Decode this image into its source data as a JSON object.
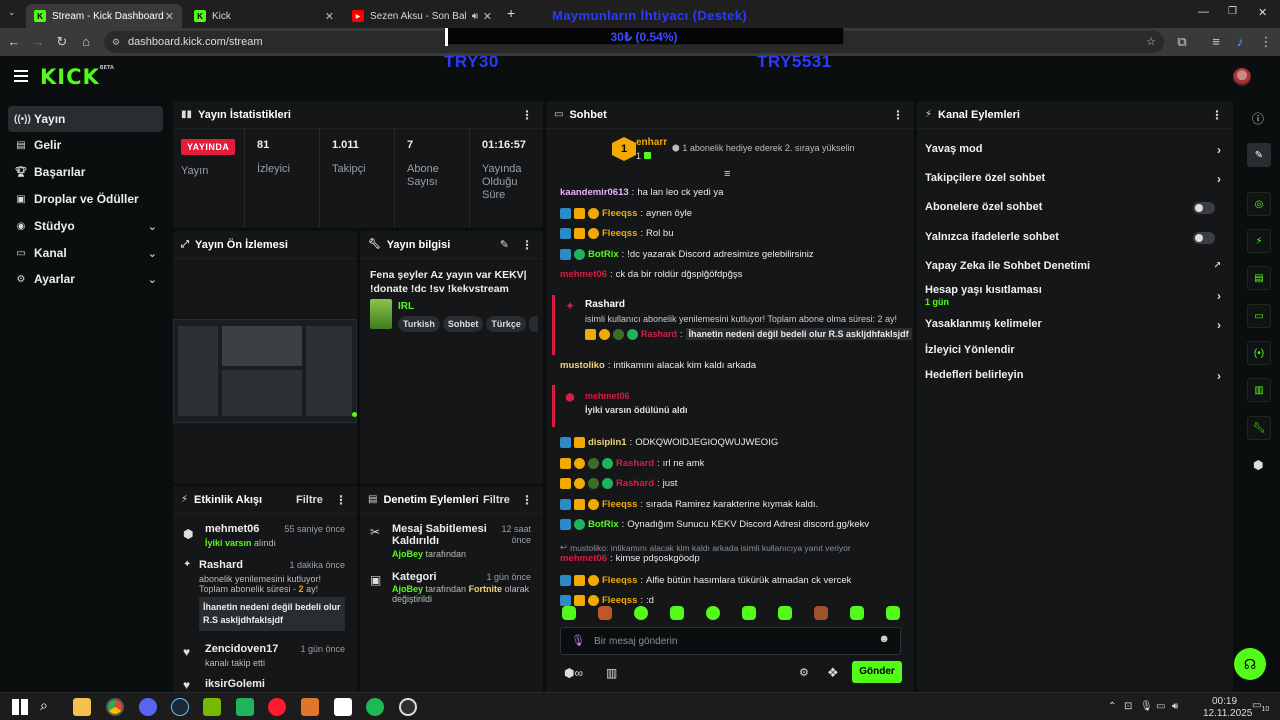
{
  "browser": {
    "tabs": [
      {
        "title": "Stream - Kick Dashboard",
        "active": true
      },
      {
        "title": "Kick",
        "active": false
      },
      {
        "title": "Sezen Aksu - Son Bakış (Ly",
        "active": false
      }
    ],
    "url": "dashboard.kick.com/stream"
  },
  "overlay": {
    "title": "Maymunların İhtiyacı (Destek)",
    "progress_text": "30₺ (0.54%)",
    "goal_left": "TRY30",
    "goal_right": "TRY5531",
    "progress": 0.0054
  },
  "kick": {
    "logo": "KICK",
    "logo_sup": "BETA"
  },
  "sidebar": {
    "items": [
      {
        "label": "Yayın",
        "icon": "broadcast-icon"
      },
      {
        "label": "Gelir",
        "icon": "revenue-icon"
      },
      {
        "label": "Başarılar",
        "icon": "trophy-icon"
      },
      {
        "label": "Droplar ve Ödüller",
        "icon": "gift-icon"
      },
      {
        "label": "Stüdyo",
        "icon": "studio-icon"
      },
      {
        "label": "Kanal",
        "icon": "channel-icon"
      },
      {
        "label": "Ayarlar",
        "icon": "gear-icon"
      }
    ]
  },
  "stats": {
    "title": "Yayın İstatistikleri",
    "live_badge": "YAYINDA",
    "live_label": "Yayın",
    "viewers": "81",
    "viewers_label": "İzleyici",
    "followers": "1.011",
    "followers_label": "Takipçi",
    "subs": "7",
    "subs_label": "Abone Sayısı",
    "duration": "01:16:57",
    "duration_label": "Yayında Olduğu Süre"
  },
  "preview": {
    "title": "Yayın Ön İzlemesi"
  },
  "info": {
    "title": "Yayın bilgisi",
    "stream_title": "Fena şeyler Az yayın var KEKV| !donate !dc !sv !kekvstream",
    "category": "IRL",
    "tags": [
      "Turkish",
      "Sohbet",
      "Türkçe"
    ]
  },
  "activity": {
    "title": "Etkinlik Akışı",
    "filter": "Filtre",
    "items": [
      {
        "name": "mehmet06",
        "time": "55 saniye önce",
        "sub_green": "İyiki varsın",
        "sub_rest": " alındı"
      },
      {
        "name": "Rashard",
        "time": "1 dakika önce",
        "line1": "abonelik yenilemesini kutluyor!",
        "line2a": "Toplam abonelik süresi - ",
        "line2b": "2",
        "line2c": " ay!",
        "message": "İhanetin nedeni değil bedeli olur R.S askljdhfaklsjdf"
      },
      {
        "name": "Zencidoven17",
        "time": "1 gün önce",
        "sub": "kanalı takip etti"
      },
      {
        "name": "iksirGolemi",
        "time": ""
      }
    ]
  },
  "moderation": {
    "title": "Denetim Eylemleri",
    "filter": "Filtre",
    "items": [
      {
        "title1": "Mesaj Sabitlemesi",
        "title2": "Kaldırıldı",
        "time1": "12 saat",
        "time2": "önce",
        "by": "AjoBey",
        "by_suffix": " tarafından"
      },
      {
        "title1": "Kategori",
        "time1": "1 gün önce",
        "by": "AjoBey",
        "by_suffix": " tarafından ",
        "target": "Fortnite",
        "target_suffix": " olarak",
        "line2": "değiştirildi"
      }
    ]
  },
  "chat": {
    "title": "Sohbet",
    "pinned_user": "enharr",
    "pinned_rank": "1",
    "pinned_text": "1 abonelik hediye ederek 2. sıraya yükselin",
    "messages": [
      {
        "user": "kaandemir0613",
        "color": "#e8b3ff",
        "text": "ha lan leo ck yedi ya",
        "badges": []
      },
      {
        "user": "Fleeqss",
        "color": "#f2a900",
        "text": "aynen öyle",
        "badges": [
          "b1",
          "b2",
          "b3"
        ]
      },
      {
        "user": "Fleeqss",
        "color": "#f2a900",
        "text": "Rol bu",
        "badges": [
          "b1",
          "b2",
          "b3"
        ]
      },
      {
        "user": "BotRix",
        "color": "#53fc18",
        "text": "!dc yazarak Discord adresimize gelebilirsiniz",
        "badges": [
          "b1",
          "b4"
        ]
      },
      {
        "user": "mehmet06",
        "color": "#d91c41",
        "text": "ck da bir roldür dğsplğöfdpğşs",
        "badges": []
      }
    ],
    "highlight1": {
      "user": "Rashard",
      "line1": "isimli kullanıcı abonelik yenilemesini kutluyor! Toplam abone olma süresi: 2 ay!",
      "msg_user": "Rashard",
      "msg_text": "İhanetin nedeni değil bedeli olur R.S askljdhfaklsjdf"
    },
    "msg_after1": {
      "user": "mustoliko",
      "color": "#f2d479",
      "text": "intikamını alacak kim kaldı arkada"
    },
    "highlight2": {
      "user": "mehmet06",
      "text": "İyiki varsın ödülünü aldı"
    },
    "messages2": [
      {
        "user": "disiplin1",
        "color": "#f2d479",
        "text": "ODKQWOIDJEGIOQWUJWEOIG",
        "badges": [
          "b1",
          "b2"
        ]
      },
      {
        "user": "Rashard",
        "color": "#d91c41",
        "text": "ırl ne amk",
        "badges": [
          "b2",
          "b3",
          "b5",
          "b4"
        ]
      },
      {
        "user": "Rashard",
        "color": "#d91c41",
        "text": "just",
        "badges": [
          "b2",
          "b3",
          "b5",
          "b4"
        ]
      },
      {
        "user": "Fleeqss",
        "color": "#f2a900",
        "text": "sırada Ramirez karakterine kıymak kaldı.",
        "badges": [
          "b1",
          "b2",
          "b3"
        ]
      },
      {
        "user": "BotRix",
        "color": "#53fc18",
        "text": "Oynadığım Sunucu KEKV Discord Adresi discord.gg/kekv",
        "badges": [
          "b1",
          "b4"
        ]
      }
    ],
    "reply_ctx": "mustoliko: intikamını alacak kim kaldı arkada isimli kullanıcıya yanıt veriyor",
    "reply_msg": {
      "user": "mehmet06",
      "color": "#d91c41",
      "text": "kimse pdşoskgöodp"
    },
    "messages3": [
      {
        "user": "Fleeqss",
        "color": "#f2a900",
        "text": "Alfie bütün hasımlara tükürük atmadan ck vercek",
        "badges": [
          "b1",
          "b2",
          "b3"
        ]
      },
      {
        "user": "Fleeqss",
        "color": "#f2a900",
        "text": ":d",
        "badges": [
          "b1",
          "b2",
          "b3"
        ]
      }
    ],
    "input_placeholder": "Bir mesaj gönderin",
    "send_label": "Gönder"
  },
  "channel_actions": {
    "title": "Kanal Eylemleri",
    "items": [
      {
        "label": "Yavaş mod",
        "type": "chevron"
      },
      {
        "label": "Takipçilere özel sohbet",
        "type": "chevron"
      },
      {
        "label": "Abonelere özel sohbet",
        "type": "toggle"
      },
      {
        "label": "Yalnızca ifadelerle sohbet",
        "type": "toggle"
      },
      {
        "label": "Yapay Zeka ile Sohbet Denetimi",
        "type": "external"
      },
      {
        "label": "Hesap yaşı kısıtlaması",
        "type": "chevron",
        "sub": "1 gün"
      },
      {
        "label": "Yasaklanmış kelimeler",
        "type": "chevron"
      },
      {
        "label": "İzleyici Yönlendir",
        "type": "none"
      },
      {
        "label": "Hedefleri belirleyin",
        "type": "chevron"
      }
    ]
  },
  "taskbar": {
    "time": "00:19",
    "date": "12.11.2025",
    "notif": "10"
  },
  "colors": {
    "accent": "#53fc18",
    "live": "#e41b39",
    "panel": "#141618",
    "bg": "#0b0e0f"
  }
}
